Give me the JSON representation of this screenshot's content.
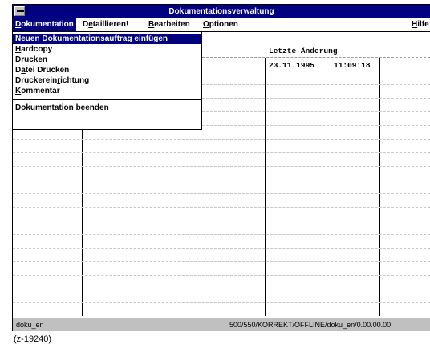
{
  "window": {
    "title": "Dokumentationsverwaltung"
  },
  "menubar": {
    "items": [
      {
        "label": "Dokumentation",
        "accel": "D",
        "rest": "okumentation"
      },
      {
        "label": "Detaillieren!",
        "pre": "D",
        "accel": "e",
        "rest": "taillieren!"
      },
      {
        "label": "Bearbeiten",
        "accel": "B",
        "rest": "earbeiten"
      },
      {
        "label": "Optionen",
        "accel": "O",
        "rest": "ptionen"
      },
      {
        "label": "Hilfe",
        "accel": "H",
        "rest": "ilfe"
      }
    ]
  },
  "dropdown": {
    "items": [
      {
        "label": "Neuen Dokumentationsauftrag einfügen",
        "pre": "",
        "accel": "N",
        "rest": "euen Dokumentationsauftrag einfügen"
      },
      {
        "label": "Hardcopy",
        "pre": "",
        "accel": "H",
        "rest": "ardcopy"
      },
      {
        "label": "Drucken",
        "pre": "",
        "accel": "D",
        "rest": "rucken"
      },
      {
        "label": "Datei Drucken",
        "pre": "D",
        "accel": "a",
        "rest": "tei Drucken"
      },
      {
        "label": "Druckereinrichtung",
        "pre": "Druckerein",
        "accel": "r",
        "rest": "ichtung"
      },
      {
        "label": "Kommentar",
        "pre": "",
        "accel": "K",
        "rest": "ommentar"
      }
    ],
    "exit": {
      "label": "Dokumentation beenden",
      "pre": "Dokumentation ",
      "accel": "b",
      "rest": "eenden"
    }
  },
  "grid": {
    "columns": [
      "",
      "",
      "Letzte Änderung",
      ""
    ],
    "rows": [
      {
        "last_change_date": "23.11.1995",
        "last_change_time": "11:09:18"
      }
    ]
  },
  "statusbar": {
    "left": "doku_en",
    "right": "500/550/KORREKT/OFFLINE/doku_en/0.00.00.00"
  },
  "caption": "(z-19240)"
}
